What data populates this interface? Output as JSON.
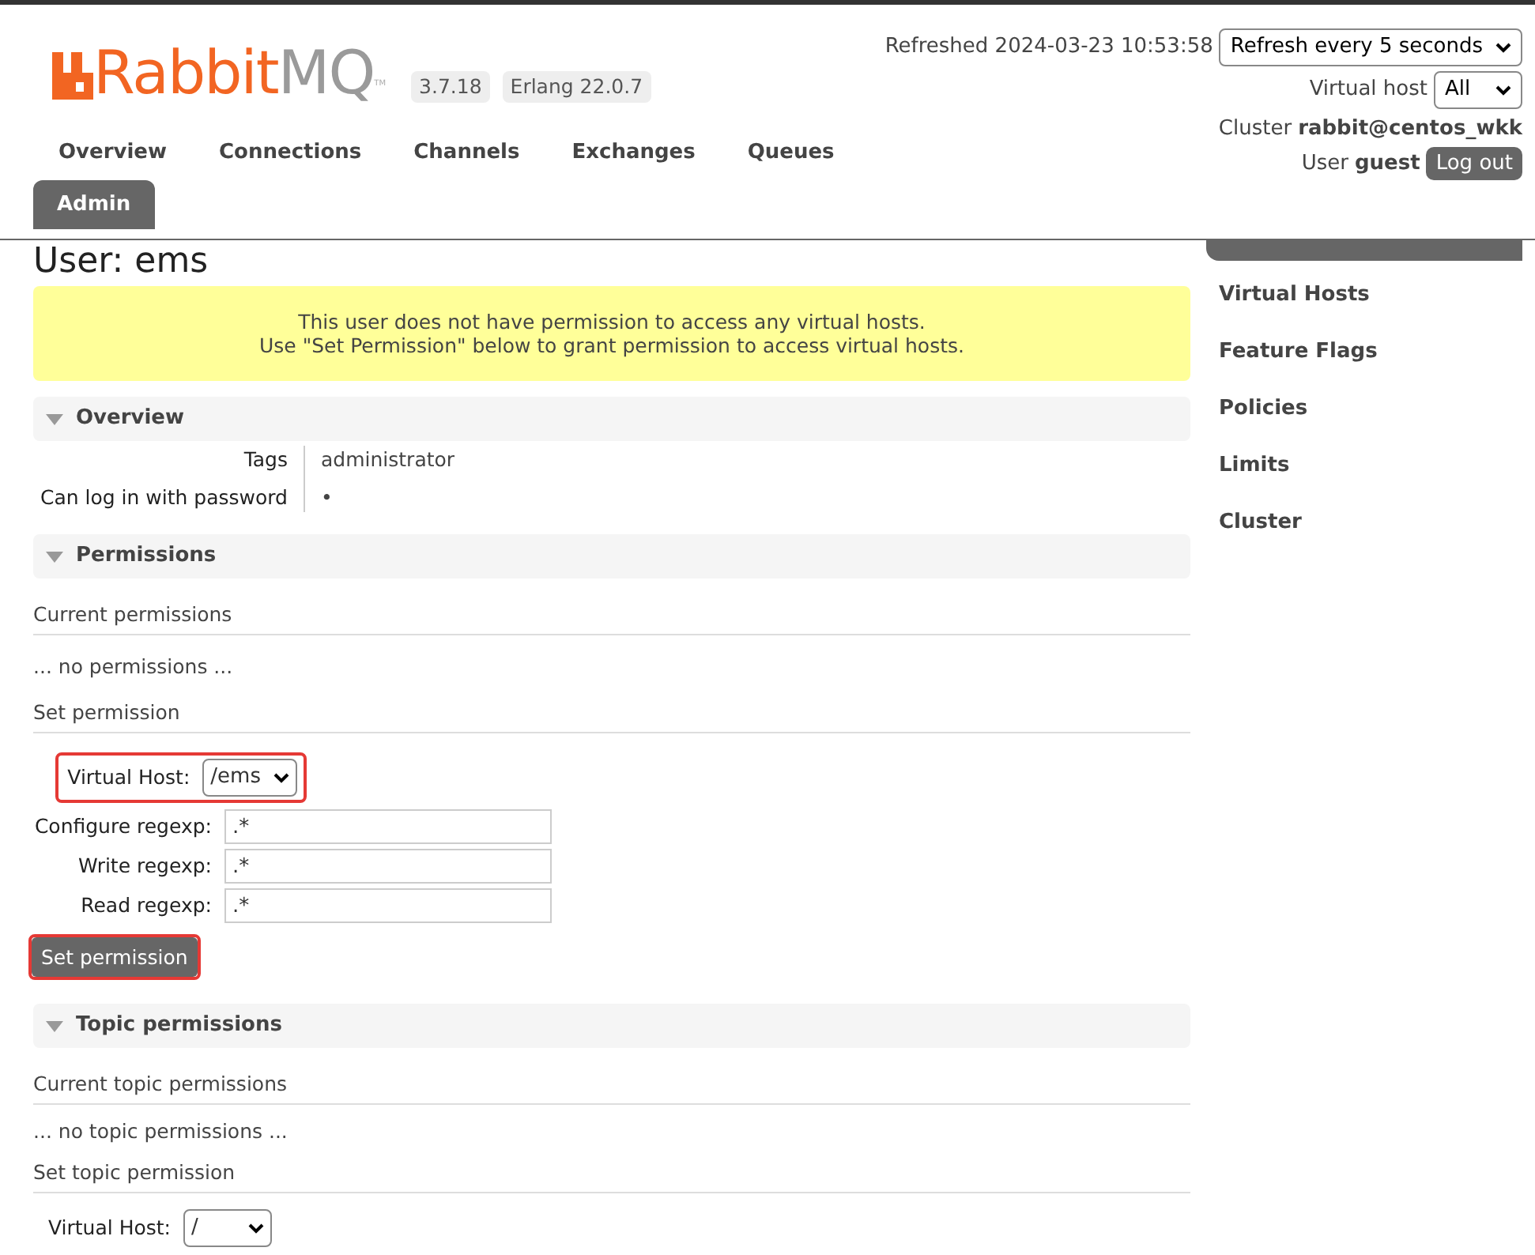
{
  "header": {
    "logo": {
      "part_1": "Rabbit",
      "part_2": "MQ",
      "mark": "TM"
    },
    "badges": [
      "3.7.18",
      "Erlang 22.0.7"
    ],
    "refreshed": "Refreshed 2024-03-23 10:53:58",
    "refresh_select": "Refresh every 5 seconds",
    "vhost_label": "Virtual host",
    "vhost_value": "All",
    "cluster_label": "Cluster",
    "cluster_value": "rabbit@centos_wkk",
    "user_label": "User",
    "user_value": "guest",
    "logout": "Log out"
  },
  "nav_tabs": [
    {
      "label": "Overview",
      "selected": false
    },
    {
      "label": "Connections",
      "selected": false
    },
    {
      "label": "Channels",
      "selected": false
    },
    {
      "label": "Exchanges",
      "selected": false
    },
    {
      "label": "Queues",
      "selected": false
    },
    {
      "label": "Admin",
      "selected": true
    }
  ],
  "page_title": "User: ems",
  "warning": [
    "This user does not have permission to access any virtual hosts.",
    "Use \"Set Permission\" below to grant permission to access virtual hosts."
  ],
  "overview": {
    "title": "Overview",
    "expanded": true,
    "rows": [
      {
        "label": "Tags",
        "value": "administrator"
      },
      {
        "label": "Can log in with password",
        "value": "•"
      }
    ]
  },
  "permissions": {
    "title": "Permissions",
    "expanded": true,
    "current_heading": "Current permissions",
    "empty_text": "... no permissions ...",
    "set_heading": "Set permission",
    "fields": [
      {
        "kind": "select",
        "label": "Virtual Host:",
        "value": "/ems",
        "highlighted": true
      },
      {
        "kind": "text",
        "label": "Configure regexp:",
        "value": ".*",
        "highlighted": false
      },
      {
        "kind": "text",
        "label": "Write regexp:",
        "value": ".*",
        "highlighted": false
      },
      {
        "kind": "text",
        "label": "Read regexp:",
        "value": ".*",
        "highlighted": false
      }
    ],
    "button": {
      "label": "Set permission",
      "highlighted": true
    }
  },
  "topic_permissions": {
    "title": "Topic permissions",
    "expanded": true,
    "current_heading": "Current topic permissions",
    "empty_text": "... no topic permissions ...",
    "set_heading": "Set topic permission",
    "fields": [
      {
        "kind": "select",
        "label": "Virtual Host:",
        "value": "/",
        "highlighted": false
      }
    ]
  },
  "sidebar": {
    "items": [
      {
        "label": "Virtual Hosts"
      },
      {
        "label": "Feature Flags"
      },
      {
        "label": "Policies"
      },
      {
        "label": "Limits"
      },
      {
        "label": "Cluster"
      }
    ]
  }
}
